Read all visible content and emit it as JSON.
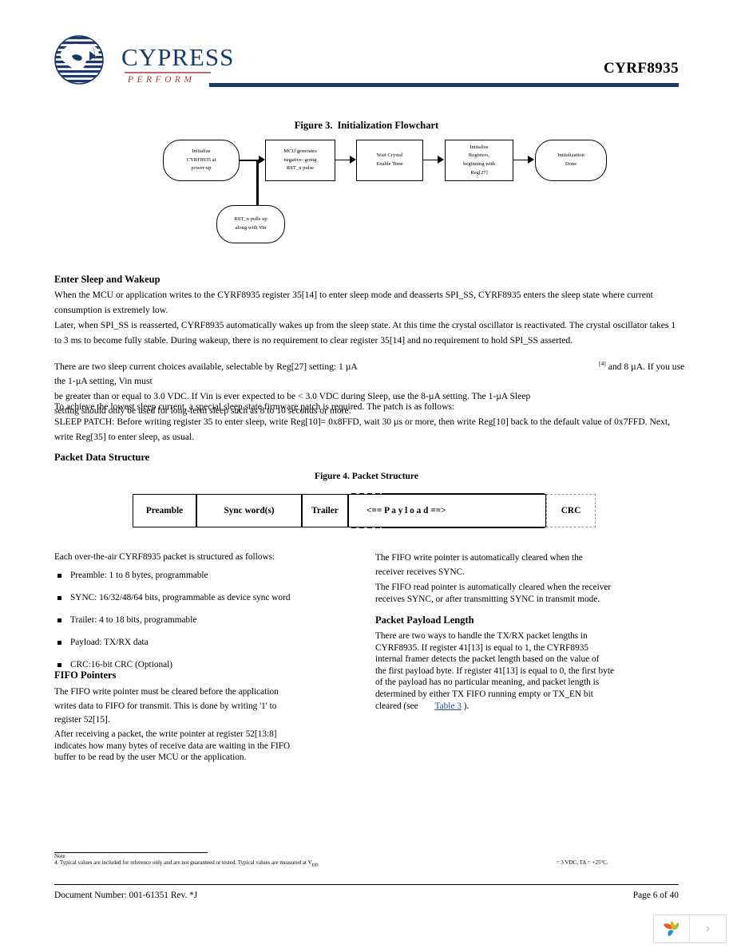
{
  "header": {
    "logo_word": "CYPRESS",
    "logo_tagline": "PERFORM",
    "part_number": "CYRF8935",
    "brand_color": "#1b3a6b",
    "accent_color": "#b03a3a"
  },
  "figure3": {
    "caption_number": "Figure 3.",
    "caption_title": "Initialization Flowchart",
    "nodes": [
      {
        "id": "start",
        "shape": "rounded",
        "lines": [
          "Initialize",
          "CYRF8935 at",
          "power-up"
        ]
      },
      {
        "id": "mcu",
        "shape": "rect",
        "lines": [
          "MCU generates",
          "negative- going",
          "RST_n pulse"
        ]
      },
      {
        "id": "wait",
        "shape": "rect",
        "lines": [
          "Wait Crystal",
          "Enable Time"
        ]
      },
      {
        "id": "initregs",
        "shape": "rect",
        "lines": [
          "Initialize",
          "Registers,",
          "beginning with",
          "Reg[27]"
        ]
      },
      {
        "id": "done",
        "shape": "rounded",
        "lines": [
          "Initialization",
          "Done"
        ]
      },
      {
        "id": "pullup",
        "shape": "rounded",
        "lines": [
          "RST_n pulls up",
          "along with Vin"
        ]
      }
    ]
  },
  "sections": {
    "enter_sleep": {
      "heading": "Enter Sleep and Wakeup",
      "p1": "When the MCU or application writes to the CYRF8935 register 35[14] to enter sleep mode and deasserts SPI_SS, CYRF8935 enters the sleep state where current consumption is extremely low.",
      "p2": "Later, when SPI_SS is reasserted, CYRF8935 automatically wakes up from the sleep state. At this time the crystal oscillator is reactivated. The crystal oscillator takes 1 to 3 ms to become fully stable. During wakeup, there is no requirement to clear register 35[14] and no requirement to hold SPI_SS asserted.",
      "p3_a": "There are two sleep current choices available, selectable by Reg[27] setting: 1 µA",
      "p3_sup": "[4]",
      "p3_b": "and 8 µA. If you use the 1-µA setting, Vin must",
      "p3_c": "be greater than or equal to 3.0 VDC. If Vin is ever expected to be < 3.0 VDC during Sleep, use the 8-µA setting. The 1-µA Sleep",
      "p3_d": "setting should only be used for long-term sleep such as 8 to 10 seconds or more.",
      "p4": "To achieve the lowest sleep current, a special sleep state firmware patch is required. The patch is as follows:",
      "p5": "SLEEP PATCH: Before writing register 35 to enter sleep, write Reg[10]= 0x8FFD, wait 30 µs or more, then write Reg[10] back to the default value of 0x7FFD. Next, write Reg[35] to enter sleep, as usual."
    },
    "packet_data_structure": {
      "heading": "Packet Data Structure"
    }
  },
  "figure4": {
    "caption_number": "Figure 4.",
    "caption_title": "Packet Structure",
    "cells": [
      {
        "label": "Preamble",
        "style": "solid"
      },
      {
        "label": "Sync word(s)",
        "style": "solid"
      },
      {
        "label": "Trailer",
        "style": "solid"
      },
      {
        "label": "<== P a y l o a d ==>",
        "style": "solid"
      },
      {
        "label": "CRC",
        "style": "dashed"
      }
    ]
  },
  "left_column": {
    "intro": "Each over-the-air CYRF8935 packet is structured as follows:",
    "bullets": [
      "Preamble: 1 to 8 bytes, programmable",
      "SYNC: 16/32/48/64 bits, programmable as device sync word",
      "Trailer: 4 to 18 bits, programmable",
      "Payload: TX/RX data",
      "CRC:16-bit CRC (Optional)"
    ],
    "fifo_heading": "FIFO Pointers",
    "fifo_p1_l1": "The FIFO write pointer must be cleared before the application",
    "fifo_p1_l2": "writes data to FIFO for transmit. This is done by writing '1' to",
    "fifo_p1_l3": "register 52[15].",
    "fifo_p2_l1": "After receiving a packet, the write pointer at register 52[13:8]",
    "fifo_p2_l2": "indicates how many bytes of receive data are waiting in the FIFO",
    "fifo_p2_l3": "buffer to be read by the user MCU or the application."
  },
  "right_column": {
    "p1_l1": "The FIFO write pointer is automatically cleared when the",
    "p1_l2": "receiver receives SYNC.",
    "p2_l1": "The FIFO read pointer is automatically cleared when the receiver",
    "p2_l2": "receives SYNC, or after transmitting SYNC in transmit mode.",
    "payload_heading": "Packet Payload Length",
    "p3_l1": "There are two ways to handle the TX/RX packet lengths in",
    "p3_l2": "CYRF8935. If register 41[13] is equal to 1, the CYRF8935",
    "p3_l3": "internal framer detects the packet length based on the value of",
    "p3_l4": "the first payload byte. If register 41[13] is equal to 0, the first byte",
    "p3_l5": "of the payload has no particular meaning, and packet length is",
    "p3_l6": "determined by either TX FIFO running empty or TX_EN bit",
    "p3_l7_a": "cleared (see",
    "p3_l7_link": "Table 3",
    "p3_l7_b": ").",
    "link_color": "#1f4e9c"
  },
  "footer": {
    "note_label": "Note",
    "note_a": "4. Typical values are included for reference only and are not guaranteed or tested. Typical values are measured at V",
    "note_sub": "DD",
    "note_b": "= 3 VDC, TA = +25°C.",
    "document_number": "Document Number: 001-61351 Rev. *J",
    "page_indicator": "Page 6 of 40"
  },
  "widget": {
    "logo_icon": "cypress-leaf-icon",
    "next_icon": "chevron-right-icon",
    "next_glyph": "›"
  }
}
